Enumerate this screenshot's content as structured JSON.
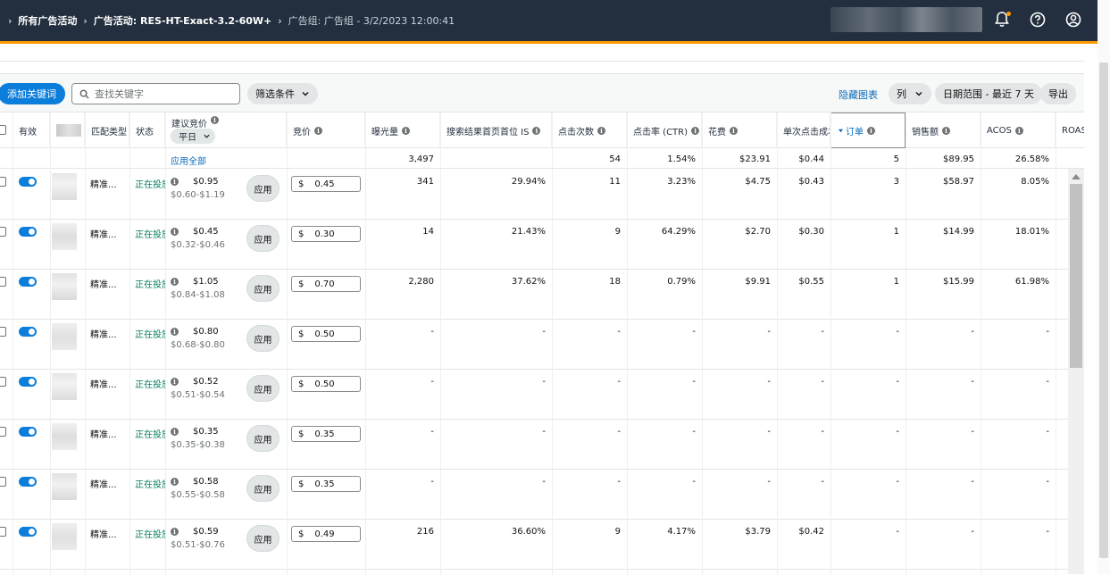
{
  "breadcrumb": {
    "all_campaigns": "所有广告活动",
    "campaign": "广告活动: RES-HT-Exact-3.2-60W+",
    "ad_group": "广告组: 广告组 - 3/2/2023 12:00:41"
  },
  "toolbar": {
    "add_keyword": "添加关键词",
    "search_placeholder": "查找关键字",
    "filter": "筛选条件",
    "hide_chart": "隐藏图表",
    "columns": "列",
    "date_range": "日期范围 - 最近 7 天",
    "export": "导出"
  },
  "headers": {
    "active": "有效",
    "match_type": "匹配类型",
    "status": "状态",
    "suggested_bid": "建议竞价",
    "weekday": "平日",
    "bid": "竞价",
    "impressions": "曝光量",
    "top_is": "搜索结果首页首位 IS",
    "clicks": "点击次数",
    "ctr": "点击率 (CTR)",
    "spend": "花费",
    "cpc": "单次点击成本",
    "orders": "订单",
    "sales": "销售额",
    "acos": "ACOS",
    "roas": "ROAS"
  },
  "totals": {
    "apply_all": "应用全部",
    "impressions": "3,497",
    "clicks": "54",
    "ctr": "1.54%",
    "spend": "$23.91",
    "cpc": "$0.44",
    "orders": "5",
    "sales": "$89.95",
    "acos": "26.58%"
  },
  "rows": [
    {
      "match": "精准...",
      "status": "正在投放",
      "sug": "$0.95",
      "range": "$0.60-$1.19",
      "apply": "应用",
      "cur": "$",
      "bid": "0.45",
      "impr": "341",
      "is": "29.94%",
      "clicks": "11",
      "ctr": "3.23%",
      "spend": "$4.75",
      "cpc": "$0.43",
      "orders": "3",
      "sales": "$58.97",
      "acos": "8.05%"
    },
    {
      "match": "精准...",
      "status": "正在投放",
      "sug": "$0.45",
      "range": "$0.32-$0.46",
      "apply": "应用",
      "cur": "$",
      "bid": "0.30",
      "impr": "14",
      "is": "21.43%",
      "clicks": "9",
      "ctr": "64.29%",
      "spend": "$2.70",
      "cpc": "$0.30",
      "orders": "1",
      "sales": "$14.99",
      "acos": "18.01%"
    },
    {
      "match": "精准...",
      "status": "正在投放",
      "sug": "$1.05",
      "range": "$0.84-$1.08",
      "apply": "应用",
      "cur": "$",
      "bid": "0.70",
      "impr": "2,280",
      "is": "37.62%",
      "clicks": "18",
      "ctr": "0.79%",
      "spend": "$9.91",
      "cpc": "$0.55",
      "orders": "1",
      "sales": "$15.99",
      "acos": "61.98%"
    },
    {
      "match": "精准...",
      "status": "正在投放",
      "sug": "$0.80",
      "range": "$0.68-$0.80",
      "apply": "应用",
      "cur": "$",
      "bid": "0.50",
      "impr": "-",
      "is": "-",
      "clicks": "-",
      "ctr": "-",
      "spend": "-",
      "cpc": "-",
      "orders": "-",
      "sales": "-",
      "acos": "-"
    },
    {
      "match": "精准...",
      "status": "正在投放",
      "sug": "$0.52",
      "range": "$0.51-$0.54",
      "apply": "应用",
      "cur": "$",
      "bid": "0.50",
      "impr": "-",
      "is": "-",
      "clicks": "-",
      "ctr": "-",
      "spend": "-",
      "cpc": "-",
      "orders": "-",
      "sales": "-",
      "acos": "-"
    },
    {
      "match": "精准...",
      "status": "正在投放",
      "sug": "$0.35",
      "range": "$0.35-$0.38",
      "apply": "应用",
      "cur": "$",
      "bid": "0.35",
      "impr": "-",
      "is": "-",
      "clicks": "-",
      "ctr": "-",
      "spend": "-",
      "cpc": "-",
      "orders": "-",
      "sales": "-",
      "acos": "-"
    },
    {
      "match": "精准...",
      "status": "正在投放",
      "sug": "$0.58",
      "range": "$0.55-$0.58",
      "apply": "应用",
      "cur": "$",
      "bid": "0.35",
      "impr": "-",
      "is": "-",
      "clicks": "-",
      "ctr": "-",
      "spend": "-",
      "cpc": "-",
      "orders": "-",
      "sales": "-",
      "acos": "-"
    },
    {
      "match": "精准...",
      "status": "正在投放",
      "sug": "$0.59",
      "range": "$0.51-$0.76",
      "apply": "应用",
      "cur": "$",
      "bid": "0.49",
      "impr": "216",
      "is": "36.60%",
      "clicks": "9",
      "ctr": "4.17%",
      "spend": "$3.79",
      "cpc": "$0.42",
      "orders": "-",
      "sales": "-",
      "acos": "-"
    }
  ]
}
